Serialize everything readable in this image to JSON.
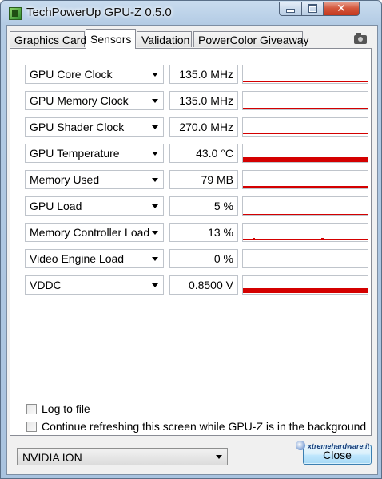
{
  "window": {
    "title": "TechPowerUp GPU-Z 0.5.0",
    "close_glyph": "✕"
  },
  "tabs": [
    {
      "label": "Graphics Card",
      "active": false
    },
    {
      "label": "Sensors",
      "active": true
    },
    {
      "label": "Validation",
      "active": false
    },
    {
      "label": "PowerColor Giveaway",
      "active": false
    }
  ],
  "sensors": [
    {
      "name": "GPU Core Clock",
      "value": "135.0 MHz"
    },
    {
      "name": "GPU Memory Clock",
      "value": "135.0 MHz"
    },
    {
      "name": "GPU Shader Clock",
      "value": "270.0 MHz"
    },
    {
      "name": "GPU Temperature",
      "value": "43.0 °C"
    },
    {
      "name": "Memory Used",
      "value": "79 MB"
    },
    {
      "name": "GPU Load",
      "value": "5 %"
    },
    {
      "name": "Memory Controller Load",
      "value": "13 %"
    },
    {
      "name": "Video Engine Load",
      "value": "0 %"
    },
    {
      "name": "VDDC",
      "value": "0.8500 V"
    }
  ],
  "options": {
    "log_to_file": {
      "label": "Log to file",
      "checked": false
    },
    "continue_refresh": {
      "label": "Continue refreshing this screen while GPU-Z is in the background",
      "checked": false
    }
  },
  "gpu_selector": {
    "selected": "NVIDIA ION"
  },
  "close_button": {
    "label": "Close"
  },
  "watermark": {
    "text": "xtremehardware.it"
  },
  "colors": {
    "graph": "#d40000",
    "title_bar": "#b3cbe4",
    "close_button": "#c4381d"
  }
}
